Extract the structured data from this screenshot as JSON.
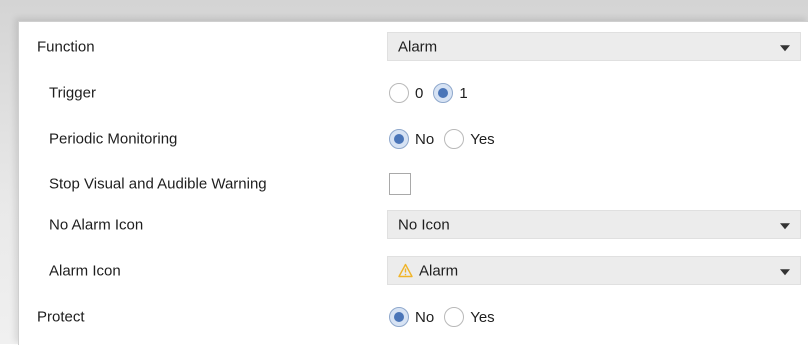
{
  "rows": {
    "function": {
      "label": "Function",
      "value": "Alarm"
    },
    "trigger": {
      "label": "Trigger",
      "options": [
        "0",
        "1"
      ],
      "selected": "1"
    },
    "periodic_monitoring": {
      "label": "Periodic Monitoring",
      "options": [
        "No",
        "Yes"
      ],
      "selected": "No"
    },
    "stop_warning": {
      "label": "Stop Visual and Audible Warning",
      "checked": false
    },
    "no_alarm_icon": {
      "label": "No Alarm Icon",
      "value": "No Icon"
    },
    "alarm_icon": {
      "label": "Alarm Icon",
      "value": "Alarm",
      "icon": "warning-icon"
    },
    "protect": {
      "label": "Protect",
      "options": [
        "No",
        "Yes"
      ],
      "selected": "No"
    }
  },
  "colors": {
    "select_bg": "#ececec",
    "radio_checked": "#4a75b8",
    "warning_icon": "#f0b429"
  }
}
